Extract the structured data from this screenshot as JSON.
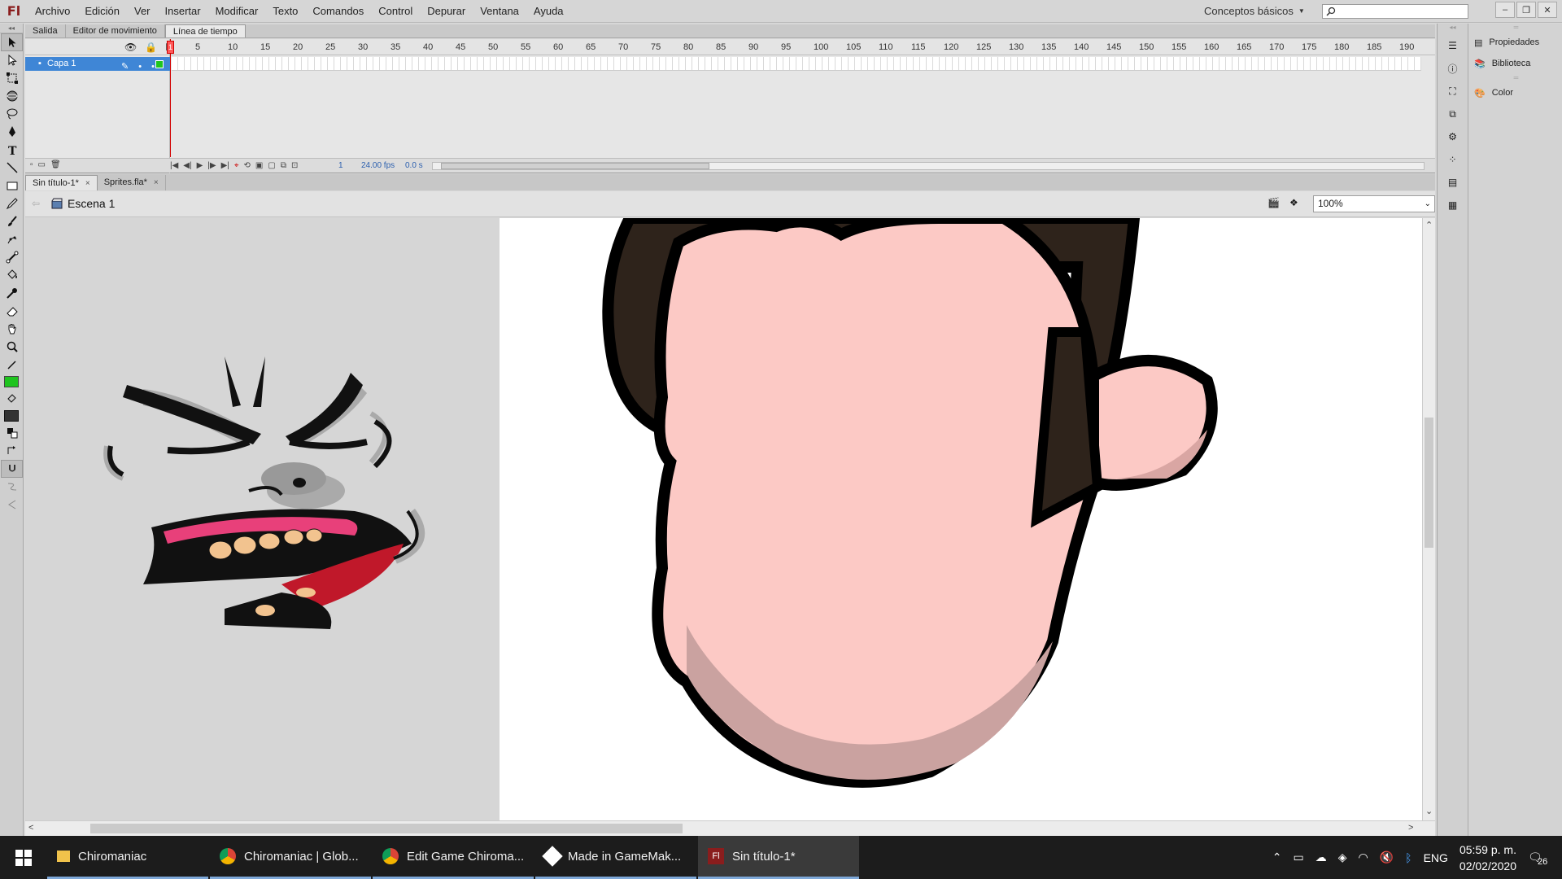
{
  "app": {
    "logo": "Fl"
  },
  "menu": [
    "Archivo",
    "Edición",
    "Ver",
    "Insertar",
    "Modificar",
    "Texto",
    "Comandos",
    "Control",
    "Depurar",
    "Ventana",
    "Ayuda"
  ],
  "workspace": {
    "label": "Conceptos básicos"
  },
  "search": {
    "placeholder": ""
  },
  "panel_tabs": [
    "Salida",
    "Editor de movimiento",
    "Línea de tiempo"
  ],
  "timeline": {
    "layer_name": "Capa 1",
    "ruler": [
      "1",
      "5",
      "10",
      "15",
      "20",
      "25",
      "30",
      "35",
      "40",
      "45",
      "50",
      "55",
      "60",
      "65",
      "70",
      "75",
      "80",
      "85",
      "90",
      "95",
      "100",
      "105",
      "110",
      "115",
      "120",
      "125",
      "130",
      "135",
      "140",
      "145",
      "150",
      "155",
      "160",
      "165",
      "170",
      "175",
      "180",
      "185",
      "190"
    ],
    "current_frame": "1",
    "fps": "24.00 fps",
    "time": "0.0 s"
  },
  "doc_tabs": [
    {
      "label": "Sin título-1*",
      "close": "×"
    },
    {
      "label": "Sprites.fla*",
      "close": "×"
    }
  ],
  "editbar": {
    "scene": "Escena 1",
    "zoom": "100%"
  },
  "right_panels": [
    "Propiedades",
    "Biblioteca",
    "Color"
  ],
  "taskbar": {
    "items": [
      {
        "label": "Chiromaniac",
        "icon": "folder-icon"
      },
      {
        "label": "Chiromaniac | Glob...",
        "icon": "chrome-icon"
      },
      {
        "label": "Edit Game Chiroma...",
        "icon": "chrome-icon"
      },
      {
        "label": "Made in GameMak...",
        "icon": "gamemaker-icon"
      },
      {
        "label": "Sin título-1*",
        "icon": "flash-icon"
      }
    ],
    "lang": "ENG",
    "time": "05:59 p. m.",
    "date": "02/02/2020",
    "notifications": "26"
  },
  "colors": {
    "stroke": "#1fc41f",
    "fill": "#333333",
    "layer_selected": "#3f86d6",
    "skin": "#fcc9c5",
    "hair": "#2e231b"
  }
}
